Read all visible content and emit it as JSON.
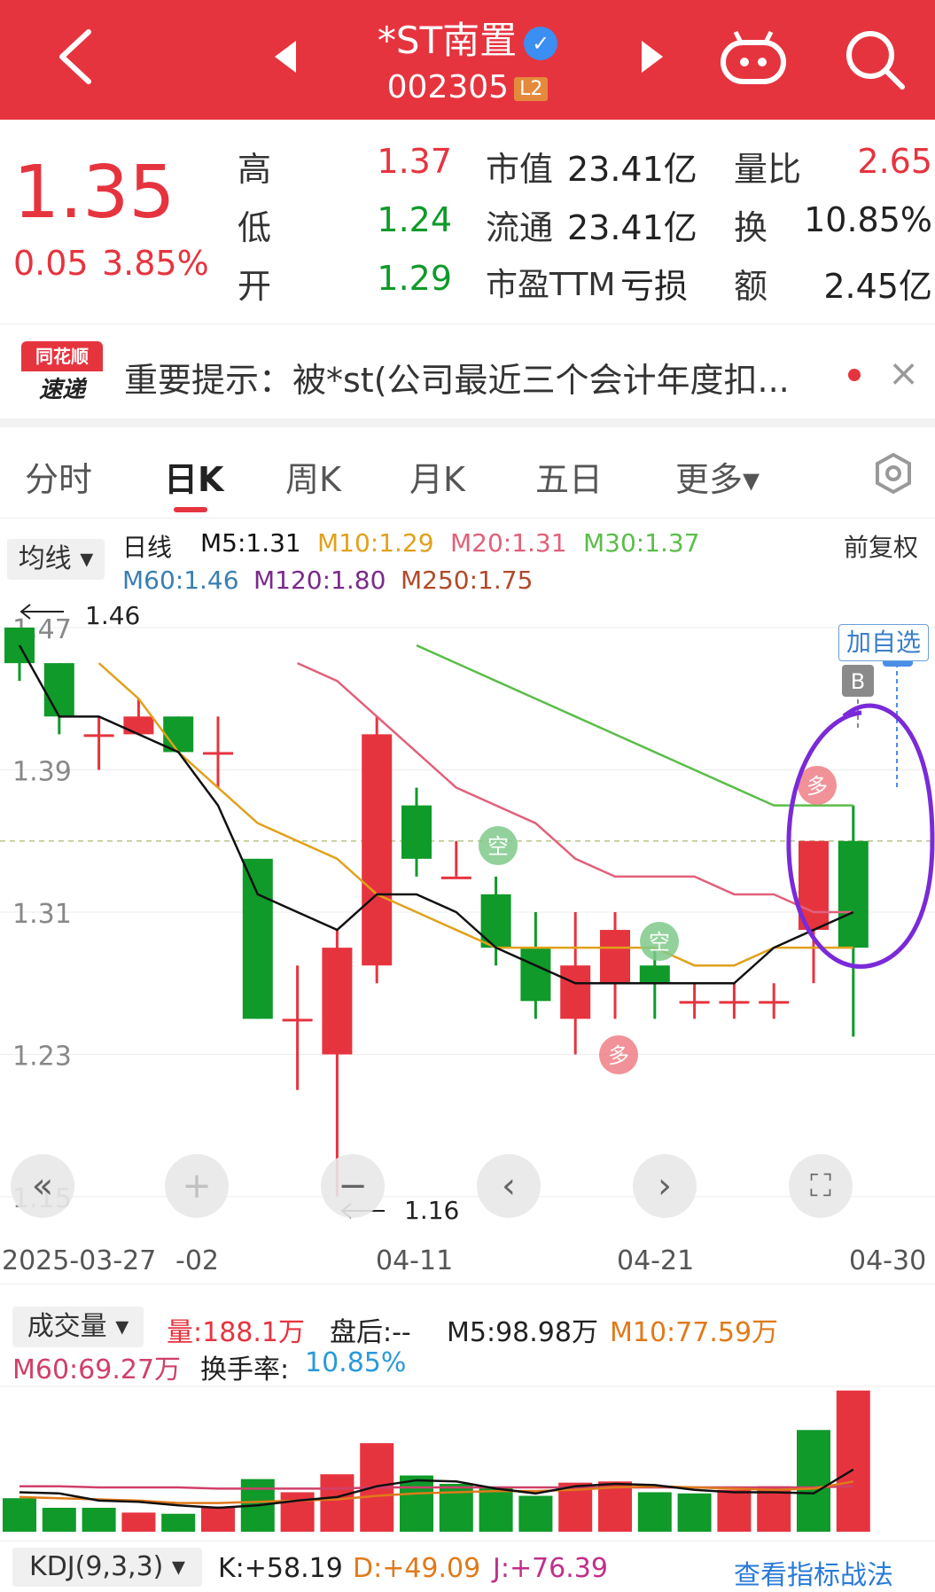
{
  "header": {
    "title": "*ST南置",
    "code": "002305",
    "level_badge": "L2",
    "icons": [
      "back-arrow-icon",
      "prev-stock-icon",
      "verified-icon",
      "next-stock-icon",
      "chat-robot-icon",
      "search-icon"
    ]
  },
  "quote": {
    "price": "1.35",
    "change": "0.05",
    "change_pct": "3.85%",
    "high_label": "高",
    "high": "1.37",
    "low_label": "低",
    "low": "1.24",
    "open_label": "开",
    "open": "1.29",
    "mktcap_label": "市值",
    "mktcap": "23.41亿",
    "float_label": "流通",
    "float": "23.41亿",
    "pe_label": "市盈TTM",
    "pe": "亏损",
    "volratio_label": "量比",
    "volratio": "2.65",
    "turnover_label": "换",
    "turnover": "10.85%",
    "amount_label": "额",
    "amount": "2.45亿"
  },
  "notice": {
    "brand_top": "同花顺",
    "brand_bottom": "速递",
    "text": "重要提示：被*st(公司最近三个会计年度扣...",
    "close": "×"
  },
  "tabs": [
    {
      "label": "分时"
    },
    {
      "label": "日K"
    },
    {
      "label": "周K"
    },
    {
      "label": "月K"
    },
    {
      "label": "五日"
    },
    {
      "label": "更多▾"
    }
  ],
  "ma_legend": {
    "selector": "均线 ▾",
    "line": "日线",
    "m5": "M5:1.31",
    "m10": "M10:1.29",
    "m20": "M20:1.31",
    "m30": "M30:1.37",
    "m60": "M60:1.46",
    "m120": "M120:1.80",
    "m250": "M250:1.75",
    "adjust": "前复权"
  },
  "chart_labels": {
    "add_watch": "加自选",
    "high_marker": "1.46",
    "low_marker": "1.16",
    "y_ticks": [
      "1.47",
      "1.39",
      "1.31",
      "1.23",
      "1.15"
    ],
    "x_ticks": [
      "2025-03-27",
      "-02",
      "04-11",
      "04-21",
      "04-30"
    ],
    "sell_badge": "S",
    "buy_badge": "B",
    "kong": "空",
    "duo": "多"
  },
  "volume_legend": {
    "selector": "成交量 ▾",
    "vol": "量:188.1万",
    "after": "盘后:--",
    "m5": "M5:98.98万",
    "m10": "M10:77.59万",
    "m60": "M60:69.27万",
    "turnover_label": "换手率:",
    "turnover": "10.85%"
  },
  "kdj": {
    "selector": "KDJ(9,3,3) ▾",
    "k": "K:+58.19",
    "d": "D:+49.09",
    "j": "J:+76.39",
    "link": "查看指标战法"
  },
  "colors": {
    "up": "#e6343f",
    "down": "#0f9a2a",
    "header": "#e6343f",
    "ma5": "#111111",
    "ma10": "#e1a11a",
    "ma20": "#e2607a",
    "ma30": "#5cbd4a"
  },
  "chart_data": {
    "type": "candlestick",
    "ylim": [
      1.15,
      1.47
    ],
    "candles": [
      {
        "o": 1.47,
        "c": 1.45,
        "h": 1.47,
        "l": 1.44
      },
      {
        "o": 1.45,
        "c": 1.42,
        "h": 1.45,
        "l": 1.41
      },
      {
        "o": 1.41,
        "c": 1.41,
        "h": 1.42,
        "l": 1.39
      },
      {
        "o": 1.41,
        "c": 1.42,
        "h": 1.43,
        "l": 1.41
      },
      {
        "o": 1.42,
        "c": 1.4,
        "h": 1.42,
        "l": 1.4
      },
      {
        "o": 1.4,
        "c": 1.4,
        "h": 1.42,
        "l": 1.38
      },
      {
        "o": 1.34,
        "c": 1.25,
        "h": 1.34,
        "l": 1.25
      },
      {
        "o": 1.25,
        "c": 1.25,
        "h": 1.28,
        "l": 1.21
      },
      {
        "o": 1.23,
        "c": 1.29,
        "h": 1.3,
        "l": 1.15
      },
      {
        "o": 1.28,
        "c": 1.41,
        "h": 1.42,
        "l": 1.27
      },
      {
        "o": 1.37,
        "c": 1.34,
        "h": 1.38,
        "l": 1.33
      },
      {
        "o": 1.33,
        "c": 1.33,
        "h": 1.35,
        "l": 1.33
      },
      {
        "o": 1.32,
        "c": 1.29,
        "h": 1.33,
        "l": 1.28
      },
      {
        "o": 1.29,
        "c": 1.26,
        "h": 1.31,
        "l": 1.25
      },
      {
        "o": 1.25,
        "c": 1.28,
        "h": 1.31,
        "l": 1.23
      },
      {
        "o": 1.27,
        "c": 1.3,
        "h": 1.31,
        "l": 1.25
      },
      {
        "o": 1.28,
        "c": 1.27,
        "h": 1.29,
        "l": 1.25
      },
      {
        "o": 1.26,
        "c": 1.26,
        "h": 1.27,
        "l": 1.25
      },
      {
        "o": 1.26,
        "c": 1.26,
        "h": 1.27,
        "l": 1.25
      },
      {
        "o": 1.26,
        "c": 1.26,
        "h": 1.27,
        "l": 1.25
      },
      {
        "o": 1.3,
        "c": 1.35,
        "h": 1.35,
        "l": 1.27
      },
      {
        "o": 1.35,
        "c": 1.29,
        "h": 1.37,
        "l": 1.24
      }
    ],
    "ma5": [
      1.46,
      1.42,
      1.42,
      1.41,
      1.4,
      1.37,
      1.32,
      1.31,
      1.3,
      1.32,
      1.32,
      1.31,
      1.29,
      1.28,
      1.27,
      1.27,
      1.27,
      1.27,
      1.27,
      1.29,
      1.3,
      1.31
    ],
    "ma10": [
      null,
      null,
      1.45,
      1.43,
      1.4,
      1.38,
      1.36,
      1.35,
      1.34,
      1.32,
      1.31,
      1.3,
      1.29,
      1.29,
      1.29,
      1.29,
      1.29,
      1.28,
      1.28,
      1.29,
      1.29,
      1.29
    ],
    "ma20": [
      null,
      null,
      null,
      null,
      null,
      null,
      null,
      1.45,
      1.44,
      1.42,
      1.4,
      1.38,
      1.37,
      1.36,
      1.34,
      1.33,
      1.33,
      1.33,
      1.32,
      1.32,
      1.31,
      1.31
    ],
    "ma30": [
      null,
      null,
      null,
      null,
      null,
      null,
      null,
      null,
      null,
      null,
      1.46,
      1.45,
      1.44,
      1.43,
      1.42,
      1.41,
      1.4,
      1.39,
      1.38,
      1.37,
      1.37,
      1.37
    ],
    "volume": [
      {
        "v": 28,
        "up": false
      },
      {
        "v": 20,
        "up": false
      },
      {
        "v": 20,
        "up": false
      },
      {
        "v": 16,
        "up": true
      },
      {
        "v": 15,
        "up": false
      },
      {
        "v": 21,
        "up": true
      },
      {
        "v": 44,
        "up": false
      },
      {
        "v": 33,
        "up": true
      },
      {
        "v": 48,
        "up": true
      },
      {
        "v": 74,
        "up": true
      },
      {
        "v": 47,
        "up": false
      },
      {
        "v": 40,
        "up": false
      },
      {
        "v": 37,
        "up": false
      },
      {
        "v": 30,
        "up": false
      },
      {
        "v": 41,
        "up": true
      },
      {
        "v": 42,
        "up": true
      },
      {
        "v": 33,
        "up": false
      },
      {
        "v": 32,
        "up": false
      },
      {
        "v": 35,
        "up": true
      },
      {
        "v": 38,
        "up": true
      },
      {
        "v": 85,
        "up": false
      },
      {
        "v": 118,
        "up": true
      }
    ],
    "vol_ma5": [
      33,
      32,
      26,
      25,
      22,
      20,
      22,
      26,
      29,
      38,
      43,
      42,
      36,
      32,
      38,
      40,
      39,
      35,
      33,
      33,
      32,
      52
    ],
    "vol_ma10": [
      29,
      28,
      27,
      26,
      24,
      24,
      25,
      26,
      27,
      30,
      32,
      33,
      34,
      34,
      35,
      37,
      38,
      37,
      36,
      35,
      36,
      42
    ],
    "vol_ma60": [
      38,
      38,
      37,
      37,
      37,
      36,
      36,
      36,
      36,
      37,
      37,
      37,
      37,
      37,
      37,
      37,
      37,
      37,
      37,
      37,
      37,
      38
    ]
  }
}
